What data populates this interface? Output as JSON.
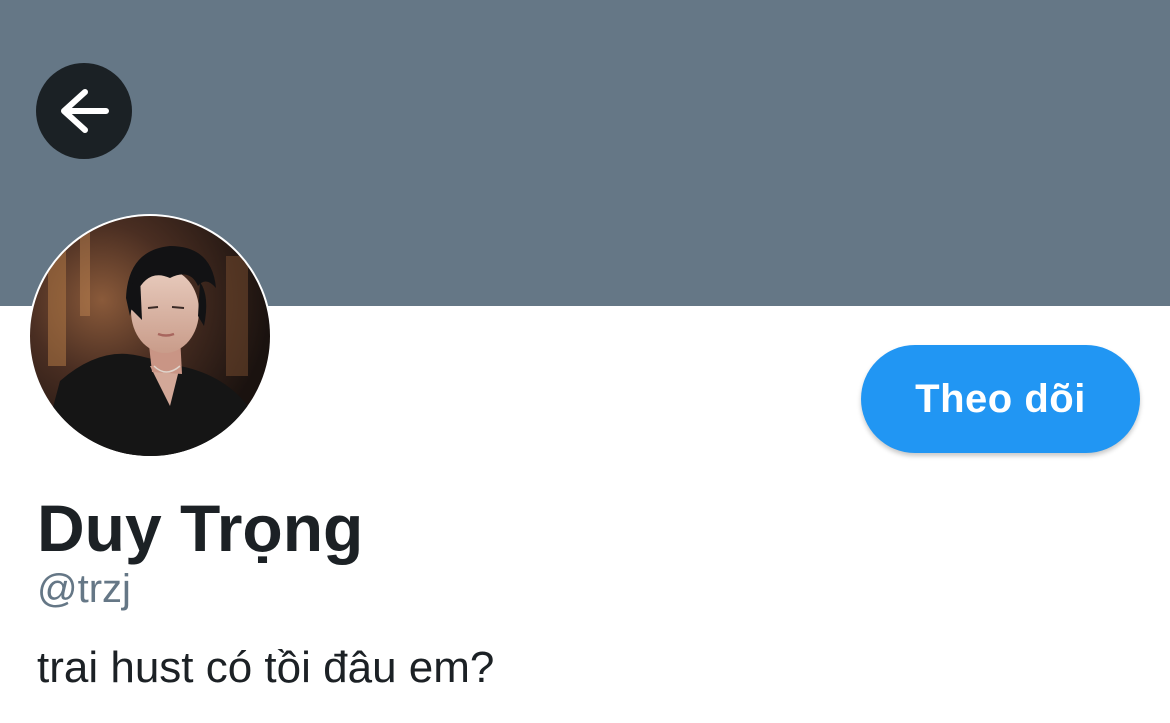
{
  "header": {
    "banner_color": "#657786",
    "back_icon": "arrow-left-icon"
  },
  "profile": {
    "display_name": "Duy Trọng",
    "handle": "@trzj",
    "bio": "trai hust có tồi đâu em?",
    "avatar": "profile-photo"
  },
  "actions": {
    "follow_label": "Theo dõi",
    "follow_color": "#2196f3"
  }
}
